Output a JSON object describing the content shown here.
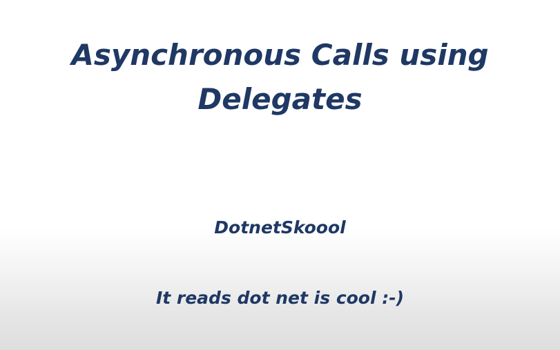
{
  "slide": {
    "title_line1": "Asynchronous Calls using",
    "title_line2": "Delegates",
    "author": "DotnetSkoool",
    "tagline": "It reads dot net is cool :-)"
  },
  "colors": {
    "text": "#1f3864",
    "background_top": "#ffffff",
    "background_bottom": "#dedede"
  }
}
